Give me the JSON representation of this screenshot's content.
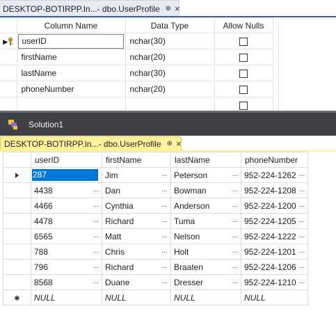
{
  "designer_tab": {
    "title": "DESKTOP-BOTIRPP.In...- dbo.UserProfile",
    "pin_glyph": "⊕",
    "close_glyph": "×"
  },
  "designer": {
    "headers": {
      "column_name": "Column Name",
      "data_type": "Data Type",
      "allow_nulls": "Allow Nulls"
    },
    "rows": [
      {
        "name": "userID",
        "type": "nchar(30)",
        "allow_nulls": false,
        "primary_key": true
      },
      {
        "name": "firstName",
        "type": "nchar(20)",
        "allow_nulls": false
      },
      {
        "name": "lastName",
        "type": "nchar(30)",
        "allow_nulls": false
      },
      {
        "name": "phoneNumber",
        "type": "nchar(20)",
        "allow_nulls": false
      },
      {
        "name": "",
        "type": "",
        "allow_nulls": false
      }
    ]
  },
  "solution": {
    "label": "Solution1",
    "icon": "solution-icon"
  },
  "data_tab": {
    "title": "DESKTOP-BOTIRPP.In...- dbo.UserProfile",
    "pin_glyph": "⊕",
    "close_glyph": "×",
    "accent": "#fff29d"
  },
  "data_grid": {
    "headers": [
      "userID",
      "firstName",
      "lastName",
      "phoneNumber"
    ],
    "rows": [
      [
        "287",
        "Jim",
        "Peterson",
        "952-224-1262"
      ],
      [
        "4438",
        "Dan",
        "Bowman",
        "952-224-1208"
      ],
      [
        "4466",
        "Cynthia",
        "Anderson",
        "952-224-1200"
      ],
      [
        "4478",
        "Richard",
        "Tuma",
        "952-224-1205"
      ],
      [
        "6565",
        "Matt",
        "Nelson",
        "952-224-1222"
      ],
      [
        "788",
        "Chris",
        "Holt",
        "952-224-1201"
      ],
      [
        "796",
        "Richard",
        "Braaten",
        "952-224-1206"
      ],
      [
        "8568",
        "Duane",
        "Dresser",
        "952-224-1210"
      ]
    ],
    "new_row": [
      "NULL",
      "NULL",
      "NULL",
      "NULL"
    ],
    "ellipsis": "..."
  }
}
